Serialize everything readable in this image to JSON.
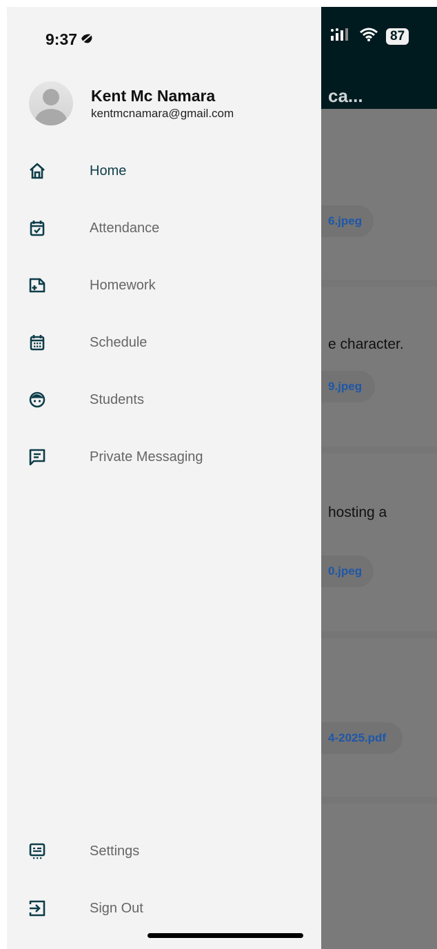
{
  "status_bar": {
    "time": "9:37",
    "battery": "87"
  },
  "background_app": {
    "title": "ca...",
    "cards": [
      {
        "text": "",
        "attachment": "6.jpeg"
      },
      {
        "text": "e character.",
        "attachment": "9.jpeg"
      },
      {
        "text": "hosting a",
        "attachment": "0.jpeg"
      },
      {
        "text": "",
        "attachment": "4-2025.pdf"
      }
    ]
  },
  "profile": {
    "name": "Kent Mc Namara",
    "email": "kentmcnamara@gmail.com"
  },
  "menu": {
    "home": "Home",
    "attendance": "Attendance",
    "homework": "Homework",
    "schedule": "Schedule",
    "students": "Students",
    "private_messaging": "Private Messaging",
    "settings": "Settings",
    "sign_out": "Sign Out"
  },
  "colors": {
    "accent": "#0e3d4a",
    "header": "#001b20",
    "link": "#1f57a8"
  }
}
